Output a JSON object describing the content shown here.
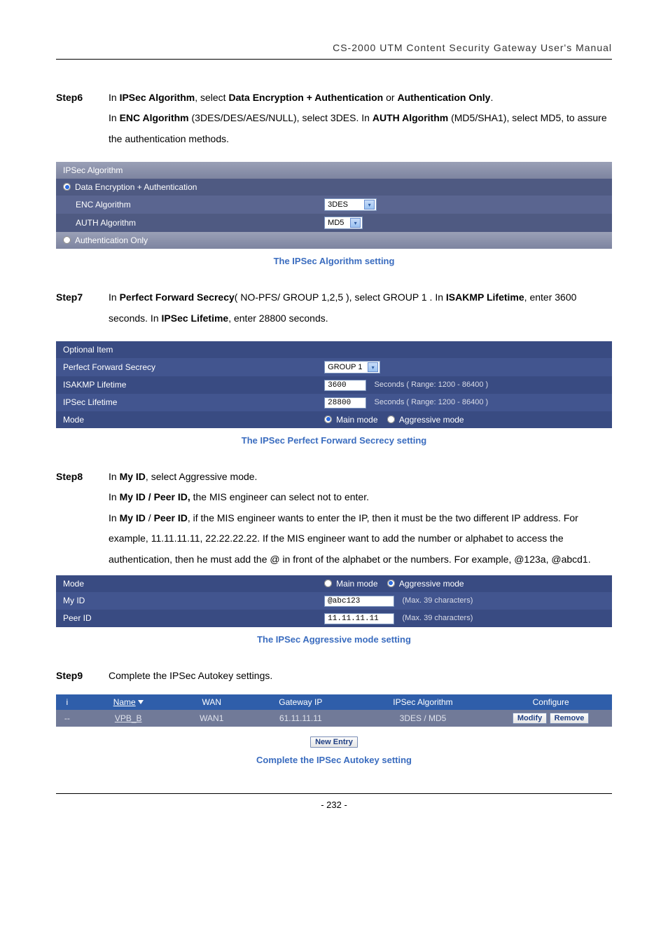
{
  "header": "CS-2000 UTM Content Security Gateway User's Manual",
  "step6": {
    "label": "Step6",
    "line1_a": "In ",
    "line1_b": "IPSec Algorithm",
    "line1_c": ", select ",
    "line1_d": "Data Encryption + Authentication",
    "line1_e": " or ",
    "line1_f": "Authentication Only",
    "line1_g": ".",
    "line2_a": "In ",
    "line2_b": "ENC Algorithm",
    "line2_c": " (3DES/DES/AES/NULL), select 3DES. In ",
    "line2_d": "AUTH Algorithm",
    "line2_e": " (MD5/SHA1), select MD5, to assure the authentication methods."
  },
  "ipsec_alg": {
    "header": "IPSec Algorithm",
    "opt1": "Data Encryption + Authentication",
    "enc_label": "ENC Algorithm",
    "enc_value": "3DES",
    "auth_label": "AUTH Algorithm",
    "auth_value": "MD5",
    "opt2": "Authentication Only"
  },
  "caption1": "The IPSec Algorithm setting",
  "step7": {
    "label": "Step7",
    "a": "In ",
    "b": "Perfect Forward Secrecy",
    "c": "( NO-PFS/ GROUP 1,2,5 ), select GROUP 1 . In ",
    "d": "ISAKMP Lifetime",
    "e": ", enter 3600 seconds. In ",
    "f": "IPSec Lifetime",
    "g": ", enter 28800 seconds."
  },
  "opt_item": {
    "header": "Optional Item",
    "pfs_label": "Perfect Forward Secrecy",
    "pfs_value": "GROUP 1",
    "isakmp_label": "ISAKMP Lifetime",
    "isakmp_value": "3600",
    "isakmp_hint": "Seconds  ( Range: 1200 - 86400 )",
    "ipsec_label": "IPSec Lifetime",
    "ipsec_value": "28800",
    "ipsec_hint": "Seconds  ( Range: 1200 - 86400 )",
    "mode_label": "Mode",
    "mode_main": "Main mode",
    "mode_agg": "Aggressive mode"
  },
  "caption2": "The IPSec Perfect Forward Secrecy setting",
  "step8": {
    "label": "Step8",
    "l1a": "In ",
    "l1b": "My ID",
    "l1c": ", select Aggressive mode.",
    "l2a": "In ",
    "l2b": "My ID / Peer ID,",
    "l2c": " the MIS engineer can select not to enter.",
    "l3a": "In ",
    "l3b": "My ID",
    "l3c": " / ",
    "l3d": "Peer ID",
    "l3e": ", if the MIS engineer wants to enter the IP, then it must be the two different IP address. For example, 11.11.11.11, 22.22.22.22. If the MIS engineer want to add the number or alphabet to access the authentication, then he must add the @ in front of the alphabet or the numbers. For example, @123a, @abcd1."
  },
  "mode_box": {
    "mode_label": "Mode",
    "mode_main": "Main mode",
    "mode_agg": "Aggressive mode",
    "myid_label": "My ID",
    "myid_value": "@abc123",
    "max_hint": "(Max. 39 characters)",
    "peerid_label": "Peer ID",
    "peerid_value": "11.11.11.11"
  },
  "caption3": "The IPSec Aggressive mode setting",
  "step9": {
    "label": "Step9",
    "text": "Complete the IPSec Autokey settings."
  },
  "result": {
    "cols": {
      "i": "i",
      "name": "Name",
      "wan": "WAN",
      "gw": "Gateway IP",
      "alg": "IPSec Algorithm",
      "cfg": "Configure"
    },
    "row": {
      "i": "--",
      "name": "VPB_B",
      "wan": "WAN1",
      "gw": "61.11.11.11",
      "alg": "3DES / MD5"
    },
    "modify": "Modify",
    "remove": "Remove",
    "new_entry": "New Entry"
  },
  "caption4": "Complete the IPSec Autokey setting",
  "page_num": "- 232 -"
}
